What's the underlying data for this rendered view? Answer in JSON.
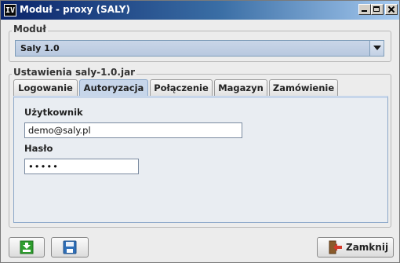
{
  "window": {
    "title": "Moduł - proxy (SALY)",
    "app_icon_text": "IV"
  },
  "modul": {
    "legend": "Moduł",
    "selected": "Saly 1.0"
  },
  "settings": {
    "legend": "Ustawienia saly-1.0.jar",
    "tabs": [
      {
        "label": "Logowanie",
        "active": false
      },
      {
        "label": "Autoryzacja",
        "active": true
      },
      {
        "label": "Połączenie",
        "active": false
      },
      {
        "label": "Magazyn",
        "active": false
      },
      {
        "label": "Zamówienie",
        "active": false
      }
    ],
    "user_label": "Użytkownik",
    "user_value": "demo@saly.pl",
    "password_label": "Hasło",
    "password_value": "•••••"
  },
  "buttons": {
    "close_label": "Zamknij"
  },
  "colors": {
    "title_bar": "#0a246a",
    "select_bg": "#c9d6e8",
    "active_tab": "#c7d6ea",
    "download_icon": "#2e9e2e",
    "save_icon": "#2f6fb8",
    "close_icon": "#d23a2a"
  },
  "icons": {
    "download": "download-icon",
    "save": "floppy-disk-icon",
    "close": "door-exit-icon"
  }
}
